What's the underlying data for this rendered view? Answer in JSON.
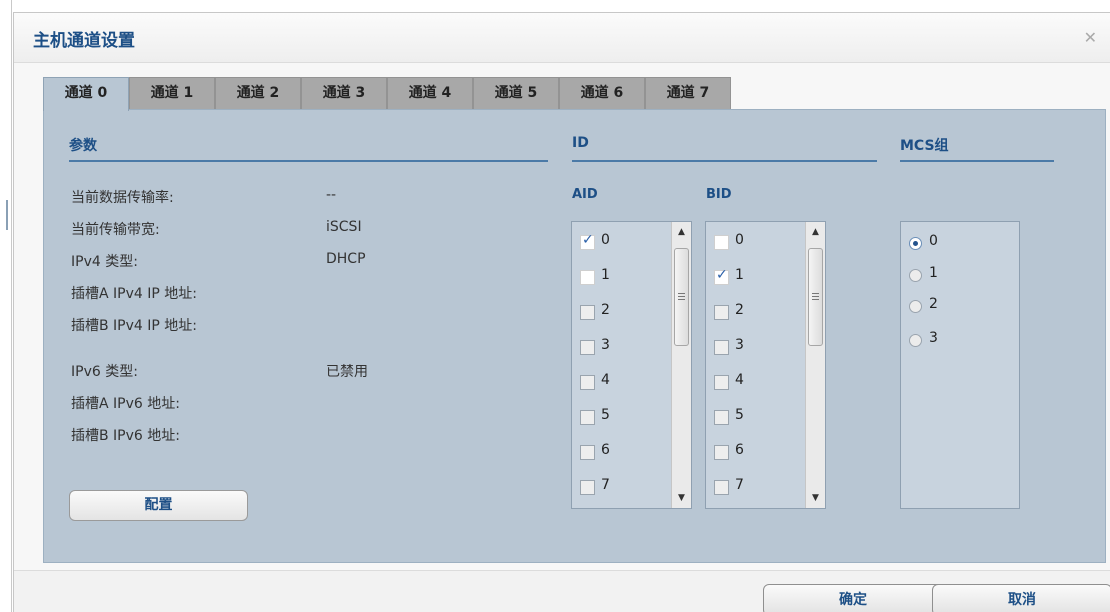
{
  "dialog": {
    "title": "主机通道设置",
    "close_icon": "close-icon"
  },
  "tabs": [
    {
      "label": "通道 0",
      "active": true
    },
    {
      "label": "通道 1",
      "active": false
    },
    {
      "label": "通道 2",
      "active": false
    },
    {
      "label": "通道 3",
      "active": false
    },
    {
      "label": "通道 4",
      "active": false
    },
    {
      "label": "通道 5",
      "active": false
    },
    {
      "label": "通道 6",
      "active": false
    },
    {
      "label": "通道 7",
      "active": false
    }
  ],
  "params": {
    "heading": "参数",
    "rows": [
      {
        "label": "当前数据传输率:",
        "value": "--"
      },
      {
        "label": "当前传输带宽:",
        "value": "iSCSI"
      },
      {
        "label": "IPv4 类型:",
        "value": "DHCP"
      },
      {
        "label": "插槽A IPv4 IP 地址:",
        "value": ""
      },
      {
        "label": "插槽B IPv4 IP 地址:",
        "value": ""
      },
      {
        "label": "IPv6 类型:",
        "value": "已禁用"
      },
      {
        "label": "插槽A IPv6 地址:",
        "value": ""
      },
      {
        "label": "插槽B IPv6 地址:",
        "value": ""
      }
    ],
    "config_button": "配置"
  },
  "id_section": {
    "heading": "ID",
    "aid_label": "AID",
    "bid_label": "BID",
    "aid_items": [
      {
        "label": "0",
        "checked": true,
        "enabled": true
      },
      {
        "label": "1",
        "checked": false,
        "enabled": true
      },
      {
        "label": "2",
        "checked": false,
        "enabled": false
      },
      {
        "label": "3",
        "checked": false,
        "enabled": false
      },
      {
        "label": "4",
        "checked": false,
        "enabled": false
      },
      {
        "label": "5",
        "checked": false,
        "enabled": false
      },
      {
        "label": "6",
        "checked": false,
        "enabled": false
      },
      {
        "label": "7",
        "checked": false,
        "enabled": false
      }
    ],
    "bid_items": [
      {
        "label": "0",
        "checked": false,
        "enabled": true
      },
      {
        "label": "1",
        "checked": true,
        "enabled": true
      },
      {
        "label": "2",
        "checked": false,
        "enabled": false
      },
      {
        "label": "3",
        "checked": false,
        "enabled": false
      },
      {
        "label": "4",
        "checked": false,
        "enabled": false
      },
      {
        "label": "5",
        "checked": false,
        "enabled": false
      },
      {
        "label": "6",
        "checked": false,
        "enabled": false
      },
      {
        "label": "7",
        "checked": false,
        "enabled": false
      }
    ]
  },
  "mcs_section": {
    "heading": "MCS组",
    "options": [
      {
        "label": "0",
        "selected": true
      },
      {
        "label": "1",
        "selected": false
      },
      {
        "label": "2",
        "selected": false
      },
      {
        "label": "3",
        "selected": false
      }
    ]
  },
  "footer": {
    "ok_label": "确定",
    "cancel_label": "取消"
  },
  "colors": {
    "title": "#1d4f86",
    "panel": "#b8c6d3",
    "active_tab": "#b8c6d3",
    "inactive_tab": "#a8a8a8",
    "section_line": "#4b7aa7"
  }
}
